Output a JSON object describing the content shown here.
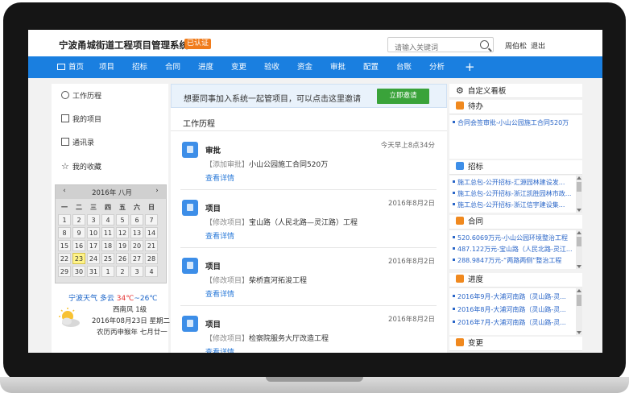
{
  "header": {
    "title": "宁波甬城街道工程项目管理系统",
    "badge": "已认证",
    "search_placeholder": "请输入关键词",
    "user": "周伯松",
    "logout": "退出"
  },
  "nav": {
    "items": [
      "首页",
      "项目",
      "招标",
      "合同",
      "进度",
      "变更",
      "验收",
      "资金",
      "审批",
      "配置",
      "台账",
      "分析"
    ],
    "plus": "+"
  },
  "sidebar": {
    "items": [
      "工作历程",
      "我的项目",
      "通讯录",
      "我的收藏"
    ],
    "calendar": {
      "title": "2016年 八月",
      "prev": "‹",
      "next": "›",
      "weekdays": [
        "一",
        "二",
        "三",
        "四",
        "五",
        "六",
        "日"
      ],
      "weeks": [
        [
          "1",
          "2",
          "3",
          "4",
          "5",
          "6",
          "7"
        ],
        [
          "8",
          "9",
          "10",
          "11",
          "12",
          "13",
          "14"
        ],
        [
          "15",
          "16",
          "17",
          "18",
          "19",
          "20",
          "21"
        ],
        [
          "22",
          "23",
          "24",
          "25",
          "26",
          "27",
          "28"
        ],
        [
          "29",
          "30",
          "31",
          "1",
          "2",
          "3",
          "4"
        ]
      ],
      "today": "23"
    },
    "weather": {
      "city": "宁波天气",
      "cond": "多云",
      "temp_high": "34℃",
      "sep": "~",
      "temp_low": "26℃",
      "wind": "西南风 1级",
      "date": "2016年08月23日 星期二",
      "lunar": "农历丙申猴年 七月廿一"
    }
  },
  "main": {
    "invite_text": "想要同事加入系统一起管项目，可以点击这里邀请",
    "invite_button": "立即邀请",
    "section_title": "工作历程",
    "entries": [
      {
        "title": "审批",
        "time": "今天早上8点34分",
        "tag": "【添加审批】",
        "desc": "小山公园施工合同520万",
        "link": "查看详情"
      },
      {
        "title": "项目",
        "time": "2016年8月2日",
        "tag": "【修改项目】",
        "desc": "宝山路（人民北路—灵江路）工程",
        "link": "查看详情"
      },
      {
        "title": "项目",
        "time": "2016年8月2日",
        "tag": "【修改项目】",
        "desc": "柴桥直河拓浚工程",
        "link": "查看详情"
      },
      {
        "title": "项目",
        "time": "2016年8月2日",
        "tag": "【修改项目】",
        "desc": "检察院服务大厅改造工程",
        "link": "查看详情"
      }
    ]
  },
  "right": {
    "custom_board": "自定义看板",
    "todo": {
      "title": "待办",
      "items": [
        "合同会签审批-小山公园施工合同520万"
      ]
    },
    "bidding": {
      "title": "招标",
      "items": [
        "施工总包-公开招标-汇源园林建设发...",
        "施工总包-公开招标-浙江凯胜园林市政...",
        "施工总包-公开招标-浙江信宇建设集..."
      ]
    },
    "contract": {
      "title": "合同",
      "items": [
        "520.6069万元-小山公园环境整治工程",
        "487.122万元-宝山路（人民北路-灵江...",
        "288.9847万元-“两路两侧”整治工程"
      ]
    },
    "progress": {
      "title": "进度",
      "items": [
        "2016年9月-大浦河南路（灵山路-灵...",
        "2016年8月-大浦河南路（灵山路-灵...",
        "2016年7月-大浦河南路（灵山路-灵..."
      ]
    },
    "change": {
      "title": "变更"
    }
  }
}
